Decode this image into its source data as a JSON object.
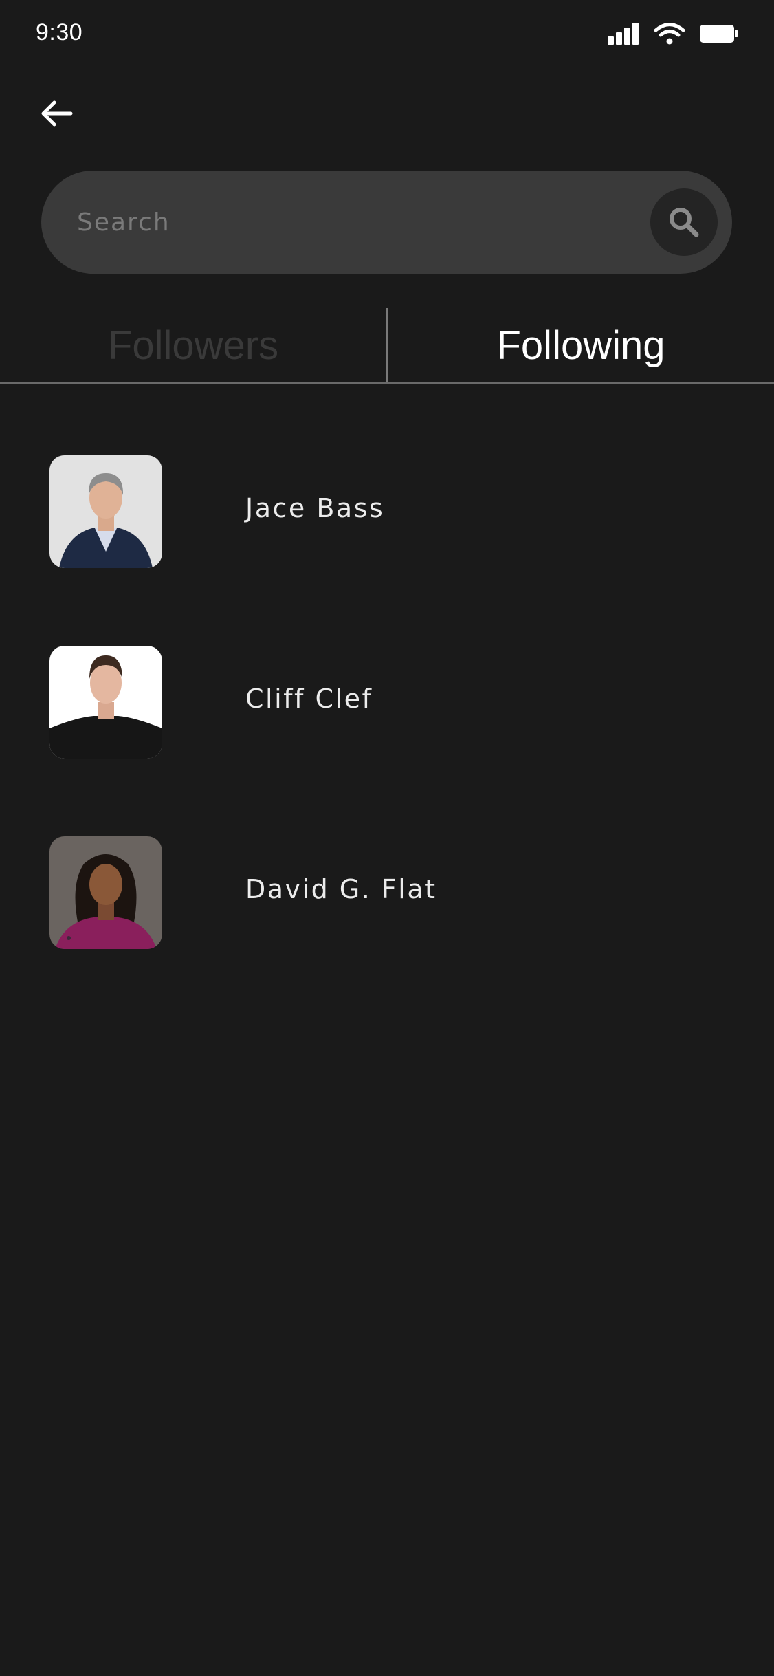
{
  "status_bar": {
    "time": "9:30",
    "icons": [
      "signal-icon",
      "wifi-icon",
      "battery-icon"
    ]
  },
  "header": {
    "back_icon": "arrow-left-icon"
  },
  "search": {
    "placeholder": "Search",
    "value": "",
    "icon": "search-icon"
  },
  "tabs": [
    {
      "label": "Followers",
      "active": false
    },
    {
      "label": "Following",
      "active": true
    }
  ],
  "following": [
    {
      "name": "Jace Bass"
    },
    {
      "name": "Cliff Clef"
    },
    {
      "name": "David G. Flat"
    }
  ],
  "colors": {
    "background": "#1a1a1a",
    "search_bg": "#3a3a3a",
    "search_button_bg": "#242424",
    "tab_active": "#ffffff",
    "tab_inactive": "#3a3a3a",
    "text": "#ececec"
  }
}
